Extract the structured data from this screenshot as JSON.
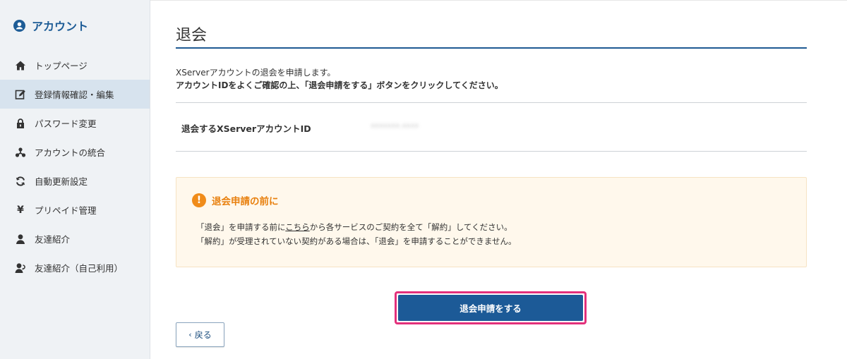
{
  "sidebar": {
    "title": "アカウント",
    "items": [
      {
        "label": "トップページ",
        "icon": "home-icon"
      },
      {
        "label": "登録情報確認・編集",
        "icon": "edit-icon",
        "active": true
      },
      {
        "label": "パスワード変更",
        "icon": "lock-icon"
      },
      {
        "label": "アカウントの統合",
        "icon": "merge-icon"
      },
      {
        "label": "自動更新設定",
        "icon": "refresh-icon"
      },
      {
        "label": "プリペイド管理",
        "icon": "yen-icon"
      },
      {
        "label": "友達紹介",
        "icon": "user-icon"
      },
      {
        "label": "友達紹介（自己利用）",
        "icon": "user-return-icon"
      }
    ]
  },
  "main": {
    "title": "退会",
    "intro_line1": "XServerアカウントの退会を申請します。",
    "intro_line2": "アカウントIDをよくご確認の上、「退会申請をする」ボタンをクリックしてください。",
    "id_label": "退会するXServerアカウントID",
    "id_value": "xxxxxxx.xxxx",
    "notice": {
      "heading": "退会申請の前に",
      "line1_before": "「退会」を申請する前に",
      "line1_link": "こちら",
      "line1_after": "から各サービスのご契約を全て「解約」してください。",
      "line2": "「解約」が受理されていない契約がある場合は、「退会」を申請することができません。"
    },
    "submit_label": "退会申請をする",
    "back_label": "戻る"
  },
  "colors": {
    "accent": "#1c5a97",
    "highlight": "#e3307b",
    "warning": "#f08c1a"
  }
}
